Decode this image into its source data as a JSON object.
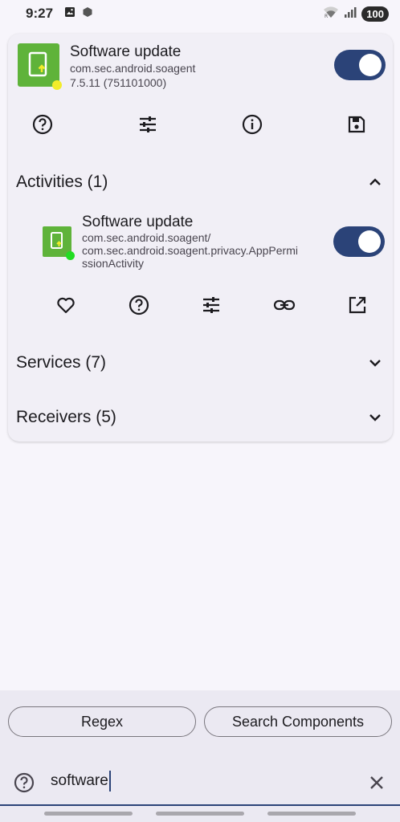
{
  "status_bar": {
    "time": "9:27",
    "battery": "100",
    "icons": [
      "image-icon",
      "hexagon-icon",
      "wifi-icon",
      "signal-icon"
    ]
  },
  "app": {
    "name": "Software update",
    "package": "com.sec.android.soagent",
    "version": "7.5.11 (751101000)",
    "enabled": true,
    "actions": [
      "help-icon",
      "tune-icon",
      "info-icon",
      "save-icon"
    ]
  },
  "sections": {
    "activities": {
      "label": "Activities (1)",
      "expanded": true,
      "items": [
        {
          "name": "Software update",
          "detail_line1": "com.sec.android.soagent/",
          "detail_line2": "com.sec.android.soagent.privacy.AppPermi",
          "detail_line3": "ssionActivity",
          "enabled": true,
          "actions": [
            "favorite-icon",
            "help-icon",
            "tune-icon",
            "link-icon",
            "open-external-icon"
          ]
        }
      ]
    },
    "services": {
      "label": "Services (7)",
      "expanded": false
    },
    "receivers": {
      "label": "Receivers (5)",
      "expanded": false
    }
  },
  "bottom": {
    "regex_label": "Regex",
    "search_components_label": "Search Components",
    "search_value": "software"
  },
  "colors": {
    "accent": "#2b4378",
    "app_icon_green": "#5fb33a",
    "status_dot_yellow": "#f2ec2a",
    "status_dot_green": "#22dd22"
  }
}
